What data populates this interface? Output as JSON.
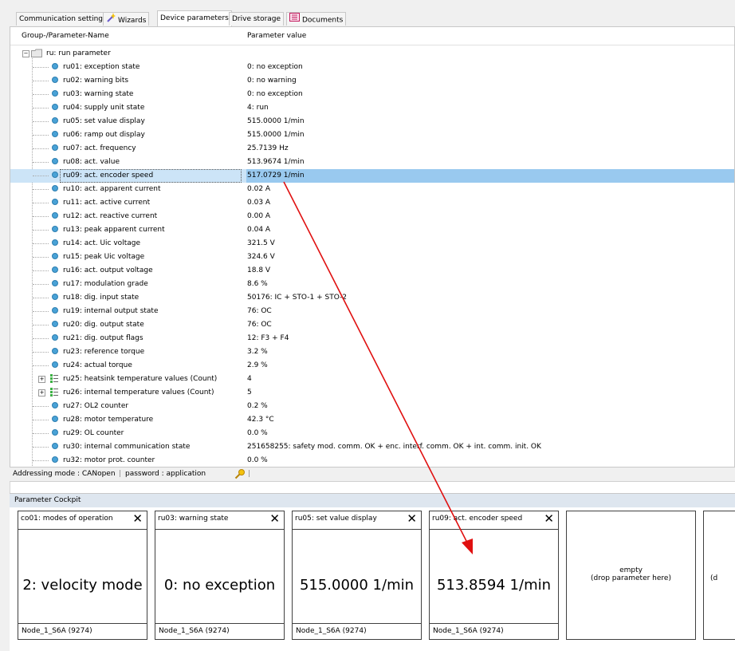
{
  "tabs": [
    {
      "label": "Communication settings",
      "icon": "none",
      "active": false
    },
    {
      "label": "Wizards",
      "icon": "wand-icon",
      "active": false
    },
    {
      "label": "Device parameters",
      "icon": "none",
      "active": true
    },
    {
      "label": "Drive storage",
      "icon": "none",
      "active": false
    },
    {
      "label": "Documents",
      "icon": "documents-icon",
      "active": false
    }
  ],
  "tree": {
    "col_name": "Group-/Parameter-Name",
    "col_value": "Parameter value",
    "group_label": "ru: run parameter",
    "rows": [
      {
        "name": "ru01: exception state",
        "value": "0: no exception"
      },
      {
        "name": "ru02: warning bits",
        "value": "0: no warning"
      },
      {
        "name": "ru03: warning state",
        "value": "0: no exception"
      },
      {
        "name": "ru04: supply unit state",
        "value": "4: run"
      },
      {
        "name": "ru05: set value display",
        "value": "515.0000 1/min"
      },
      {
        "name": "ru06: ramp out display",
        "value": "515.0000 1/min"
      },
      {
        "name": "ru07: act. frequency",
        "value": "25.7139 Hz"
      },
      {
        "name": "ru08: act. value",
        "value": "513.9674 1/min"
      },
      {
        "name": "ru09: act. encoder speed",
        "value": "517.0729 1/min",
        "selected": true
      },
      {
        "name": "ru10: act. apparent current",
        "value": "0.02 A"
      },
      {
        "name": "ru11: act. active current",
        "value": "0.03 A"
      },
      {
        "name": "ru12: act. reactive current",
        "value": "0.00 A"
      },
      {
        "name": "ru13: peak apparent current",
        "value": "0.04 A"
      },
      {
        "name": "ru14: act. Uic voltage",
        "value": "321.5 V"
      },
      {
        "name": "ru15: peak Uic voltage",
        "value": "324.6 V"
      },
      {
        "name": "ru16: act. output voltage",
        "value": "18.8 V"
      },
      {
        "name": "ru17: modulation grade",
        "value": "8.6 %"
      },
      {
        "name": "ru18: dig. input state",
        "value": "50176: IC + STO-1 + STO-2"
      },
      {
        "name": "ru19: internal output state",
        "value": "76: OC"
      },
      {
        "name": "ru20: dig. output state",
        "value": "76: OC"
      },
      {
        "name": "ru21: dig. output flags",
        "value": "12: F3 + F4"
      },
      {
        "name": "ru23: reference torque",
        "value": "3.2 %"
      },
      {
        "name": "ru24: actual torque",
        "value": "2.9 %"
      },
      {
        "name": "ru25: heatsink temperature values (Count)",
        "value": "4",
        "expandable": true
      },
      {
        "name": "ru26: internal temperature values (Count)",
        "value": "5",
        "expandable": true
      },
      {
        "name": "ru27: OL2 counter",
        "value": "0.2 %"
      },
      {
        "name": "ru28: motor temperature",
        "value": "42.3 °C"
      },
      {
        "name": "ru29: OL counter",
        "value": "0.0 %"
      },
      {
        "name": "ru30: internal communication state",
        "value": "251658255: safety mod. comm. OK + enc. interf. comm. OK + int. comm. init. OK"
      },
      {
        "name": "ru32: motor prot. counter",
        "value": "0.0 %"
      }
    ]
  },
  "status": {
    "addressing": "Addressing mode  : CANopen",
    "password": "password : application"
  },
  "cockpit": {
    "title": "Parameter Cockpit",
    "cards": [
      {
        "title": "co01: modes of operation",
        "value": "2: velocity mode",
        "node": "Node_1_S6A (9274)"
      },
      {
        "title": "ru03: warning state",
        "value": "0: no exception",
        "node": "Node_1_S6A (9274)"
      },
      {
        "title": "ru05: set value display",
        "value": "515.0000 1/min",
        "node": "Node_1_S6A (9274)"
      },
      {
        "title": "ru09: act. encoder speed",
        "value": "513.8594 1/min",
        "node": "Node_1_S6A (9274)"
      }
    ],
    "empty_title": "empty",
    "empty_hint": "(drop parameter here)",
    "partial_hint": "(d"
  },
  "colors": {
    "selection": "#cce4f7",
    "selection_value": "#99c9ef",
    "arrow": "#e01010",
    "cockpit_header": "#dee6ef"
  }
}
